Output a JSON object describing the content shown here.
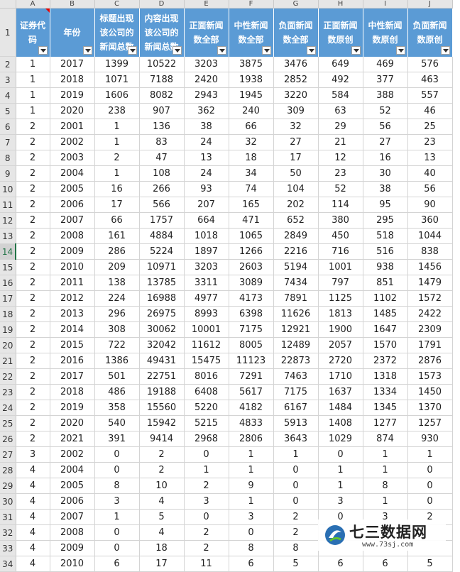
{
  "columns": [
    "A",
    "B",
    "C",
    "D",
    "E",
    "F",
    "G",
    "H",
    "I",
    "J"
  ],
  "header_row_number": "1",
  "headers": [
    "证券代码",
    "年份",
    "标题出现该公司的新闻总数",
    "内容出现该公司的新闻总数",
    "正面新闻数全部",
    "中性新闻数全部",
    "负面新闻数全部",
    "正面新闻数原创",
    "中性新闻数原创",
    "负面新闻数原创"
  ],
  "header_display": [
    "证券代码\n码",
    "年份",
    "标题出现\n该公司的\n新闻总数",
    "内容出现\n该公司的\n新闻总数",
    "正面新闻\n数全部",
    "中性新闻\n数全部",
    "负面新闻\n数全部",
    "正面新闻\n数原创",
    "中性新闻\n数原创",
    "负面新闻\n数原创"
  ],
  "active_row": "14",
  "rows": [
    [
      "2",
      "1",
      "2017",
      "1399",
      "10522",
      "3203",
      "3875",
      "3476",
      "649",
      "469",
      "576"
    ],
    [
      "3",
      "1",
      "2018",
      "1071",
      "7188",
      "2420",
      "1938",
      "2852",
      "492",
      "377",
      "463"
    ],
    [
      "4",
      "1",
      "2019",
      "1606",
      "8082",
      "2943",
      "1945",
      "3220",
      "584",
      "388",
      "557"
    ],
    [
      "5",
      "1",
      "2020",
      "238",
      "907",
      "362",
      "240",
      "309",
      "63",
      "52",
      "46"
    ],
    [
      "6",
      "2",
      "2001",
      "1",
      "136",
      "38",
      "66",
      "32",
      "29",
      "56",
      "25"
    ],
    [
      "7",
      "2",
      "2002",
      "1",
      "83",
      "24",
      "32",
      "27",
      "21",
      "27",
      "23"
    ],
    [
      "8",
      "2",
      "2003",
      "2",
      "47",
      "13",
      "18",
      "17",
      "12",
      "16",
      "13"
    ],
    [
      "9",
      "2",
      "2004",
      "1",
      "108",
      "24",
      "34",
      "50",
      "23",
      "30",
      "40"
    ],
    [
      "10",
      "2",
      "2005",
      "16",
      "266",
      "93",
      "74",
      "104",
      "52",
      "38",
      "56"
    ],
    [
      "11",
      "2",
      "2006",
      "17",
      "566",
      "207",
      "165",
      "202",
      "114",
      "95",
      "90"
    ],
    [
      "12",
      "2",
      "2007",
      "66",
      "1757",
      "664",
      "471",
      "652",
      "380",
      "295",
      "360"
    ],
    [
      "13",
      "2",
      "2008",
      "161",
      "4884",
      "1018",
      "1065",
      "2849",
      "450",
      "518",
      "1044"
    ],
    [
      "14",
      "2",
      "2009",
      "286",
      "5224",
      "1897",
      "1266",
      "2216",
      "716",
      "516",
      "838"
    ],
    [
      "15",
      "2",
      "2010",
      "209",
      "10971",
      "3203",
      "2603",
      "5194",
      "1001",
      "938",
      "1456"
    ],
    [
      "16",
      "2",
      "2011",
      "138",
      "13785",
      "3311",
      "3089",
      "7434",
      "797",
      "851",
      "1479"
    ],
    [
      "17",
      "2",
      "2012",
      "224",
      "16988",
      "4977",
      "4173",
      "7891",
      "1125",
      "1102",
      "1572"
    ],
    [
      "18",
      "2",
      "2013",
      "296",
      "26975",
      "8993",
      "6398",
      "11626",
      "1813",
      "1485",
      "2422"
    ],
    [
      "19",
      "2",
      "2014",
      "308",
      "30062",
      "10001",
      "7175",
      "12921",
      "1900",
      "1647",
      "2309"
    ],
    [
      "20",
      "2",
      "2015",
      "722",
      "32042",
      "11612",
      "8005",
      "12489",
      "2057",
      "1570",
      "1791"
    ],
    [
      "21",
      "2",
      "2016",
      "1386",
      "49431",
      "15475",
      "11123",
      "22873",
      "2720",
      "2372",
      "2876"
    ],
    [
      "22",
      "2",
      "2017",
      "501",
      "22751",
      "8016",
      "7291",
      "7463",
      "1710",
      "1318",
      "1573"
    ],
    [
      "23",
      "2",
      "2018",
      "486",
      "19188",
      "6408",
      "5617",
      "7175",
      "1637",
      "1334",
      "1450"
    ],
    [
      "24",
      "2",
      "2019",
      "358",
      "15560",
      "5220",
      "4182",
      "6167",
      "1484",
      "1345",
      "1370"
    ],
    [
      "25",
      "2",
      "2020",
      "540",
      "15942",
      "5215",
      "4833",
      "5913",
      "1408",
      "1277",
      "1257"
    ],
    [
      "26",
      "2",
      "2021",
      "391",
      "9414",
      "2968",
      "2806",
      "3643",
      "1029",
      "874",
      "930"
    ],
    [
      "27",
      "3",
      "2002",
      "0",
      "2",
      "0",
      "1",
      "1",
      "0",
      "1",
      "1"
    ],
    [
      "28",
      "4",
      "2004",
      "0",
      "2",
      "1",
      "1",
      "0",
      "1",
      "1",
      "0"
    ],
    [
      "29",
      "4",
      "2005",
      "8",
      "10",
      "2",
      "9",
      "0",
      "1",
      "8",
      "0"
    ],
    [
      "30",
      "4",
      "2006",
      "3",
      "4",
      "3",
      "1",
      "0",
      "3",
      "1",
      "0"
    ],
    [
      "31",
      "4",
      "2007",
      "1",
      "5",
      "0",
      "3",
      "2",
      "0",
      "3",
      "2"
    ],
    [
      "32",
      "4",
      "2008",
      "0",
      "4",
      "2",
      "0",
      "2",
      "",
      "",
      ""
    ],
    [
      "33",
      "4",
      "2009",
      "0",
      "18",
      "2",
      "8",
      "8",
      "",
      "",
      ""
    ],
    [
      "34",
      "4",
      "2010",
      "6",
      "17",
      "11",
      "6",
      "5",
      "6",
      "6",
      "5"
    ]
  ],
  "watermark": {
    "title": "七三数据网",
    "url": "www.73sj.com"
  },
  "colors": {
    "header_fill": "#5b9bd5",
    "active_row": "#217346",
    "comment_marker": "#e00000"
  }
}
